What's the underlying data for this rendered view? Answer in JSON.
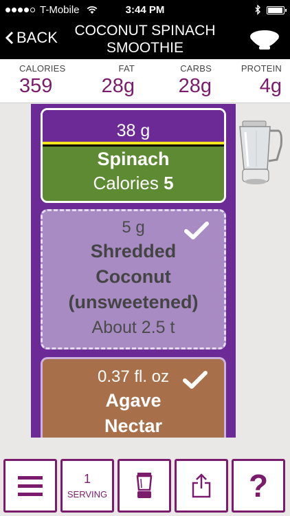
{
  "status_bar": {
    "carrier": "T-Mobile",
    "time": "3:44 PM",
    "signal_bars": 4,
    "battery_level": 0.95
  },
  "nav": {
    "back_label": "BACK",
    "title_line1": "COCONUT SPINACH",
    "title_line2": "SMOOTHIE"
  },
  "nutrition": {
    "calories_label": "CALORIES",
    "calories_value": "359",
    "fat_label": "FAT",
    "fat_value": "28g",
    "carbs_label": "CARBS",
    "carbs_value": "28g",
    "protein_label": "PROTEIN",
    "protein_value": "4g"
  },
  "ingredients": [
    {
      "amount": "38 g",
      "name": "Spinach",
      "calories_label": "Calories",
      "calories_value": "5",
      "color": "#5e8a34"
    },
    {
      "amount": "5 g",
      "name_line1": "Shredded",
      "name_line2": "Coconut",
      "name_line3": "(unsweetened)",
      "note": "About 2.5 t",
      "checked": true,
      "color": "#a98bc4"
    },
    {
      "amount": "0.37 fl. oz",
      "name_line1": "Agave",
      "name_line2": "Nectar",
      "checked": true,
      "color": "#a8704a"
    }
  ],
  "toolbar": {
    "serving_count": "1",
    "serving_label": "SERVING",
    "help_label": "?"
  },
  "colors": {
    "accent": "#7a1c6b",
    "column": "#6b2a95"
  }
}
